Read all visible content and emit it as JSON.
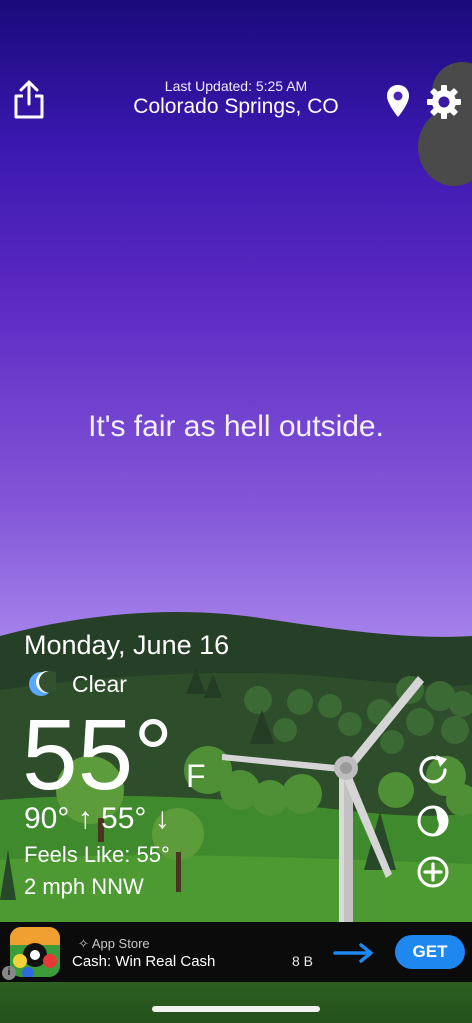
{
  "header": {
    "last_updated": "Last Updated: 5:25 AM",
    "location": "Colorado Springs, CO"
  },
  "icons": {
    "share": "share-icon",
    "location_pin": "location-pin-icon",
    "settings": "gear-icon",
    "refresh": "refresh-icon",
    "theme": "theme-icon",
    "add": "add-icon",
    "moon": "moon-icon"
  },
  "headline": "It's fair as hell outside.",
  "weather": {
    "date": "Monday, June 16",
    "condition": "Clear",
    "temperature": "55°",
    "unit": "F",
    "hi_lo": "90° ↑ 55° ↓",
    "feels_like": "Feels Like: 55°",
    "wind": "2 mph NNW"
  },
  "ad": {
    "store_label": "App Store",
    "title": "Cash: Win Real Cash",
    "size": "8 B",
    "cta": "GET",
    "info": "i"
  },
  "colors": {
    "sky_top": "#1a0a7a",
    "sky_mid": "#8458d8",
    "sky_bottom": "#c9a8f6",
    "hill_dark": "#2c4a2a",
    "hill_light": "#4e9a32",
    "get_button": "#1e88f0"
  }
}
